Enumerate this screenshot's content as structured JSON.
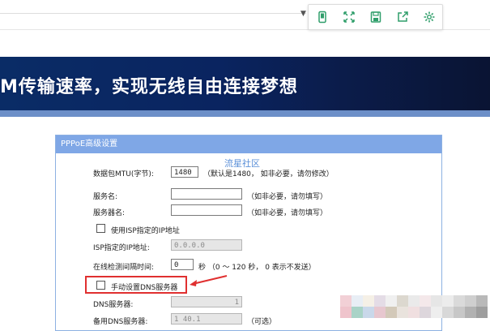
{
  "toolbar": {
    "icons": [
      "phone-icon",
      "fullscreen-icon",
      "save-icon",
      "share-icon",
      "gear-icon"
    ]
  },
  "banner": {
    "text": "M传输速率，实现无线自由连接梦想"
  },
  "panel": {
    "title": "PPPoE高级设置",
    "watermark": "流星社区",
    "mtu": {
      "label": "数据包MTU(字节):",
      "value": "1480",
      "note": "（默认是1480， 如非必要，请勿修改）"
    },
    "service_name": {
      "label": "服务名:",
      "value": "",
      "note": "（如非必要，请勿填写）"
    },
    "server_name": {
      "label": "服务器名:",
      "value": "",
      "note": "（如非必要，请勿填写）"
    },
    "use_isp_ip": {
      "label": "使用ISP指定的IP地址"
    },
    "isp_ip": {
      "label": "ISP指定的IP地址:",
      "value": "0.0.0.0"
    },
    "interval": {
      "label": "在线检测间隔时间:",
      "value": "0",
      "note": "秒  （0 ～ 120 秒， 0 表示不发送）"
    },
    "manual_dns": {
      "label": "手动设置DNS服务器"
    },
    "dns1": {
      "label": "DNS服务器:",
      "value": "1"
    },
    "dns2": {
      "label": "备用DNS服务器:",
      "value": "1   40.1",
      "note": "（可选）"
    }
  },
  "colors": {
    "banner_bg": "#0a2460",
    "panel_header": "#7fa7e6",
    "highlight": "#e03030"
  }
}
